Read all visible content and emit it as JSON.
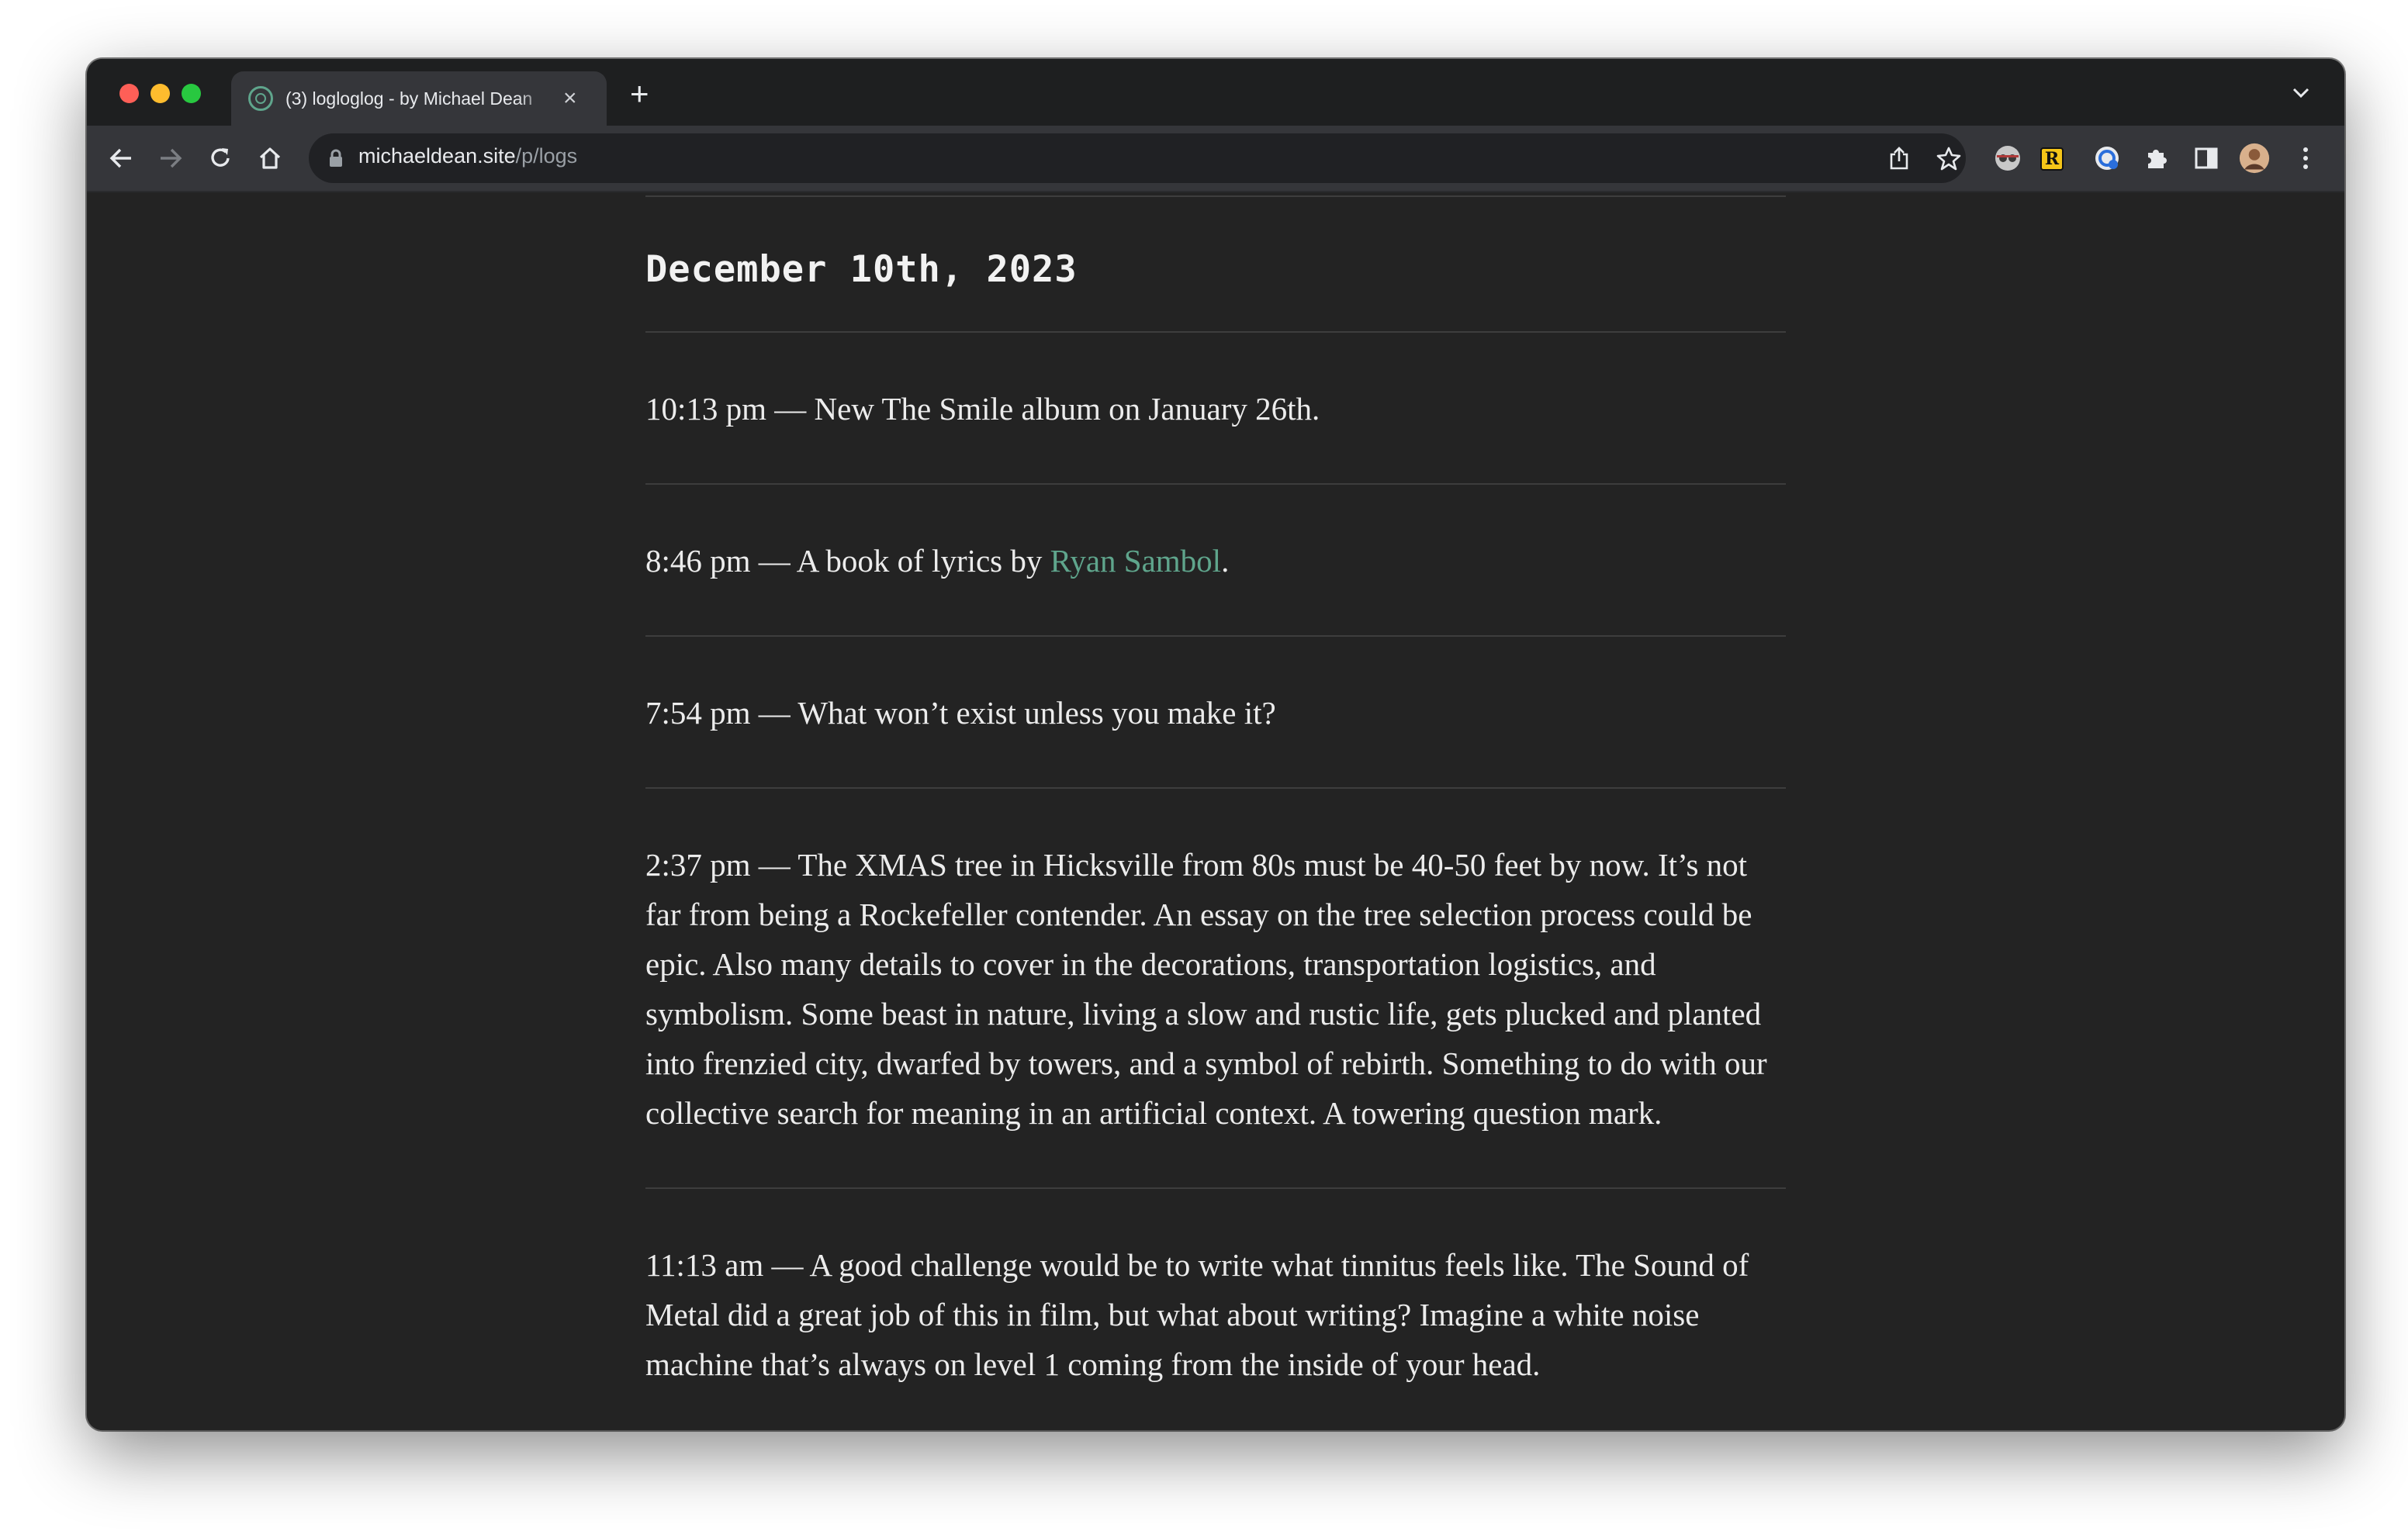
{
  "browser": {
    "tab_title": "(3) logloglog - by Michael Dean",
    "tab_close": "×",
    "new_tab": "+",
    "url_host": "michaeldean.site",
    "url_path": "/p/logs"
  },
  "page": {
    "date_heading": "December 10th, 2023",
    "entries": [
      {
        "time": "10:13 pm",
        "text": "New The Smile album on January 26th."
      },
      {
        "time": "8:46 pm",
        "text_before": "A book of lyrics by ",
        "link": "Ryan Sambol",
        "text_after": "."
      },
      {
        "time": "7:54 pm",
        "text": "What won’t exist unless you make it?"
      },
      {
        "time": "2:37 pm",
        "text": "The XMAS tree in Hicksville from 80s must be 40-50 feet by now. It’s not far from being a Rockefeller contender. An essay on the tree selection process could be epic. Also many details to cover in the decorations, transportation logistics, and symbolism. Some beast in nature, living a slow and rustic life, gets plucked and planted into frenzied city, dwarfed by towers, and a symbol of rebirth. Something to do with our collective search for meaning in an artificial context. A towering question mark."
      },
      {
        "time": "11:13 am",
        "text": "A good challenge would be to write what tinnitus feels like. The Sound of Metal did a great job of this in film, but what about writing? Imagine a white noise machine that’s always on level 1 coming from the inside of your head."
      }
    ],
    "separator": " — "
  },
  "colors": {
    "accent_link": "#5fa58c",
    "page_bg": "#232323",
    "text": "#ececec"
  }
}
